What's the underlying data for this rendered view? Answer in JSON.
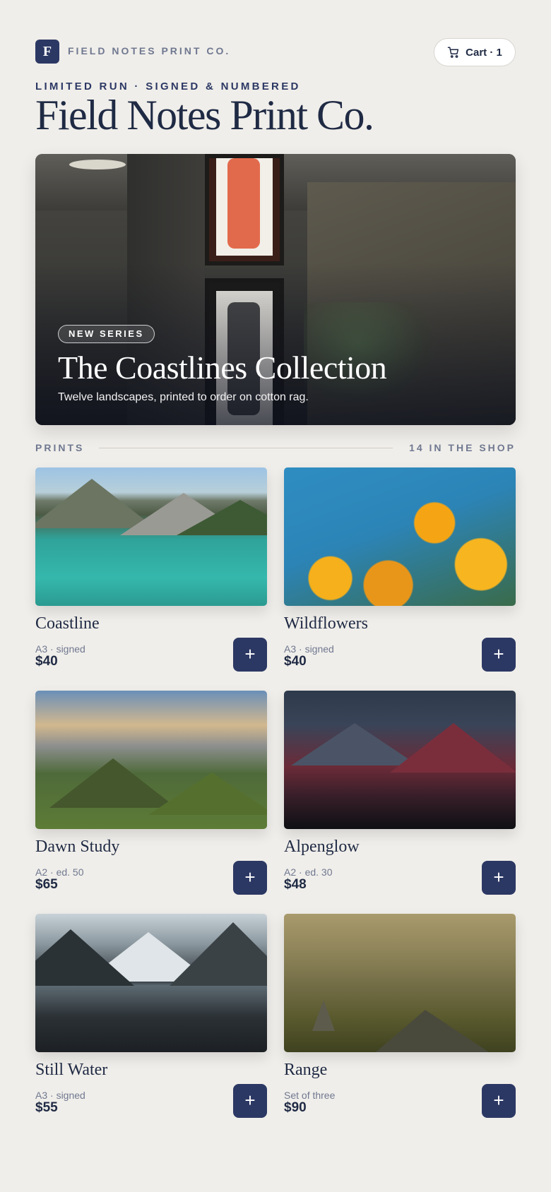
{
  "header": {
    "logo_letter": "F",
    "brand": "FIELD NOTES PRINT CO.",
    "cart_label": "Cart · 1"
  },
  "hero_intro": {
    "eyebrow": "LIMITED RUN · SIGNED & NUMBERED",
    "title": "Field Notes Print Co."
  },
  "feature": {
    "badge": "NEW SERIES",
    "title": "The Coastlines Collection",
    "subtitle": "Twelve landscapes, printed to order on cotton rag."
  },
  "section": {
    "label": "PRINTS",
    "count": "14 IN THE SHOP"
  },
  "products": [
    {
      "name": "Coastline",
      "meta": "A3 · signed",
      "price": "$40",
      "add": "+"
    },
    {
      "name": "Wildflowers",
      "meta": "A3 · signed",
      "price": "$40",
      "add": "+"
    },
    {
      "name": "Dawn Study",
      "meta": "A2 · ed. 50",
      "price": "$65",
      "add": "+"
    },
    {
      "name": "Alpenglow",
      "meta": "A2 · ed. 30",
      "price": "$48",
      "add": "+"
    },
    {
      "name": "Still Water",
      "meta": "A3 · signed",
      "price": "$55",
      "add": "+"
    },
    {
      "name": "Range",
      "meta": "Set of three",
      "price": "$90",
      "add": "+"
    }
  ],
  "colors": {
    "background": "#f0eeea",
    "accent": "#2c3864",
    "text": "#1f2a44",
    "muted": "#6f7890"
  }
}
